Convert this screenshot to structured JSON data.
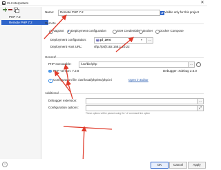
{
  "window": {
    "title": "CLI Interpreters",
    "close_glyph": "✕"
  },
  "left_panel": {
    "interpreters": [
      {
        "label": "PHP 7.2",
        "selected": false
      },
      {
        "label": "Remote PHP 7.2",
        "selected": true
      }
    ]
  },
  "form": {
    "name_label": "Name:",
    "name_value": "Remote PHP 7.2",
    "visible_only_label": "Visible only for this project",
    "visible_only_checked": true,
    "remote_section": "Remote",
    "remote_options": [
      "Vagrant",
      "Deployment configuration",
      "SSH Credentials",
      "Docker",
      "Docker Compose"
    ],
    "remote_selected": "Deployment configuration",
    "deploy_config_label": "Deployment configuration:",
    "deploy_config_value": "pi_zero",
    "deploy_host_label": "Deployment Host URL:",
    "deploy_host_value": "sftp://pi@192.168.1.20:22",
    "general_section": "General",
    "php_exec_label": "PHP executable:",
    "php_exec_value": "/usr/bin/php",
    "php_version_label": "PHP version: 7.2.8",
    "debugger_label": "Debugger: Xdebug 2.6.0",
    "config_file_label": "Configuration file: /usr/local/php/etc/php.ini",
    "open_in_editor": "Open in Editor",
    "additional_section": "Additional",
    "debugger_ext_label": "Debugger extension:",
    "debugger_ext_value": "",
    "config_options_label": "Configuration options:",
    "config_options_value": "",
    "hint_text": "These options will be passed using the '-d' command line option"
  },
  "buttons": {
    "ok": "OK",
    "cancel": "Cancel",
    "apply": "Apply"
  },
  "colors": {
    "accent": "#2f65ca",
    "annotation": "#e03a2a",
    "link": "#2a5db0"
  }
}
